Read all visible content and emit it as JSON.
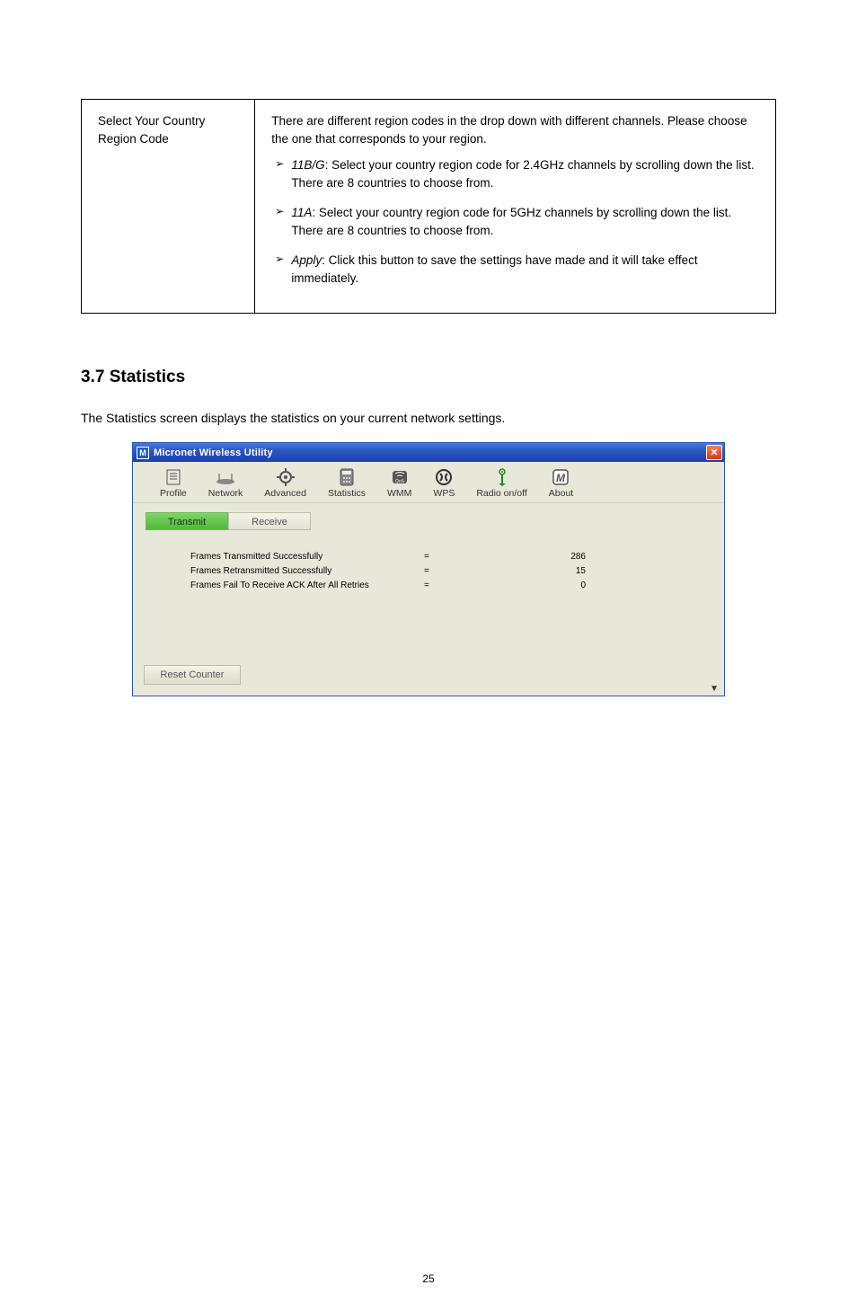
{
  "table": {
    "param_label": "Select Your Country Region Code",
    "desc_intro": "There are different region codes in the drop down with different channels. Please choose the one that corresponds to your region.",
    "items": [
      {
        "label": "11B/G",
        "text": "Select your country region code for 2.4GHz channels by scrolling down the list. There are 8 countries to choose from."
      },
      {
        "label": "11A",
        "text": "Select your country region code for 5GHz channels by scrolling down the list. There are 8 countries to choose from."
      },
      {
        "label": "Apply",
        "text": "Click this button to save the settings have made and it will take effect immediately."
      }
    ]
  },
  "section": {
    "heading": "3.7 Statistics",
    "para": "The Statistics screen displays the statistics on your current network settings."
  },
  "window": {
    "title": "Micronet Wireless Utility",
    "toolbar": [
      {
        "key": "profile",
        "label": "Profile"
      },
      {
        "key": "network",
        "label": "Network"
      },
      {
        "key": "advanced",
        "label": "Advanced"
      },
      {
        "key": "statistics",
        "label": "Statistics"
      },
      {
        "key": "wmm",
        "label": "WMM"
      },
      {
        "key": "wps",
        "label": "WPS"
      },
      {
        "key": "radio",
        "label": "Radio on/off"
      },
      {
        "key": "about",
        "label": "About"
      }
    ],
    "subtabs": {
      "transmit": "Transmit",
      "receive": "Receive"
    },
    "stats": [
      {
        "label": "Frames Transmitted Successfully",
        "value": "286"
      },
      {
        "label": "Frames Retransmitted Successfully",
        "value": "15"
      },
      {
        "label": "Frames Fail To Receive ACK After All Retries",
        "value": "0"
      }
    ],
    "reset": "Reset Counter"
  },
  "page_number": "25"
}
